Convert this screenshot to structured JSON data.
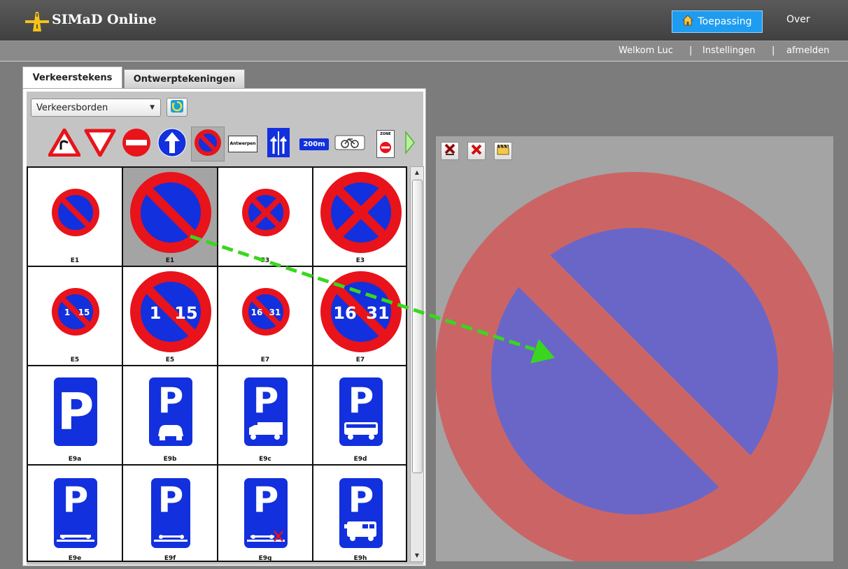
{
  "header": {
    "title": "SIMaD Online",
    "nav_app": "Toepassing",
    "nav_about": "Over"
  },
  "userbar": {
    "welcome": "Welkom Luc",
    "sep1": "|",
    "settings": "Instellingen",
    "sep2": "|",
    "logout": "afmelden"
  },
  "tabs": [
    {
      "label": "Verkeerstekens"
    },
    {
      "label": "Ontwerptekeningen"
    }
  ],
  "selector": {
    "value": "Verkeersborden"
  },
  "categories": {
    "ontwerpen_label": "Antwerpen",
    "distance_label": "200m",
    "zone_label": "ZONE"
  },
  "grid": {
    "rows": [
      [
        {
          "label": "E1"
        },
        {
          "label": "E1"
        },
        {
          "label": "E3"
        },
        {
          "label": "E3"
        }
      ],
      [
        {
          "label": "E5",
          "left": "1",
          "right": "15"
        },
        {
          "label": "E5",
          "left": "1",
          "right": "15"
        },
        {
          "label": "E7",
          "left": "16",
          "right": "31"
        },
        {
          "label": "E7",
          "left": "16",
          "right": "31"
        }
      ],
      [
        {
          "label": "E9a",
          "letter": "P"
        },
        {
          "label": "E9b",
          "letter": "P"
        },
        {
          "label": "E9c",
          "letter": "P"
        },
        {
          "label": "E9d",
          "letter": "P"
        }
      ],
      [
        {
          "label": "E9e",
          "letter": "P"
        },
        {
          "label": "E9f",
          "letter": "P"
        },
        {
          "label": "E9g",
          "letter": "P"
        },
        {
          "label": "E9h",
          "letter": "P"
        }
      ]
    ],
    "selected_index": 1
  },
  "colors": {
    "sign_red": "#e8131b",
    "sign_blue": "#1230dd",
    "preview_red": "#cb6565",
    "preview_blue": "#6a66c8",
    "drag_arrow": "#3ad61f",
    "accent": "#1e9cf0"
  }
}
